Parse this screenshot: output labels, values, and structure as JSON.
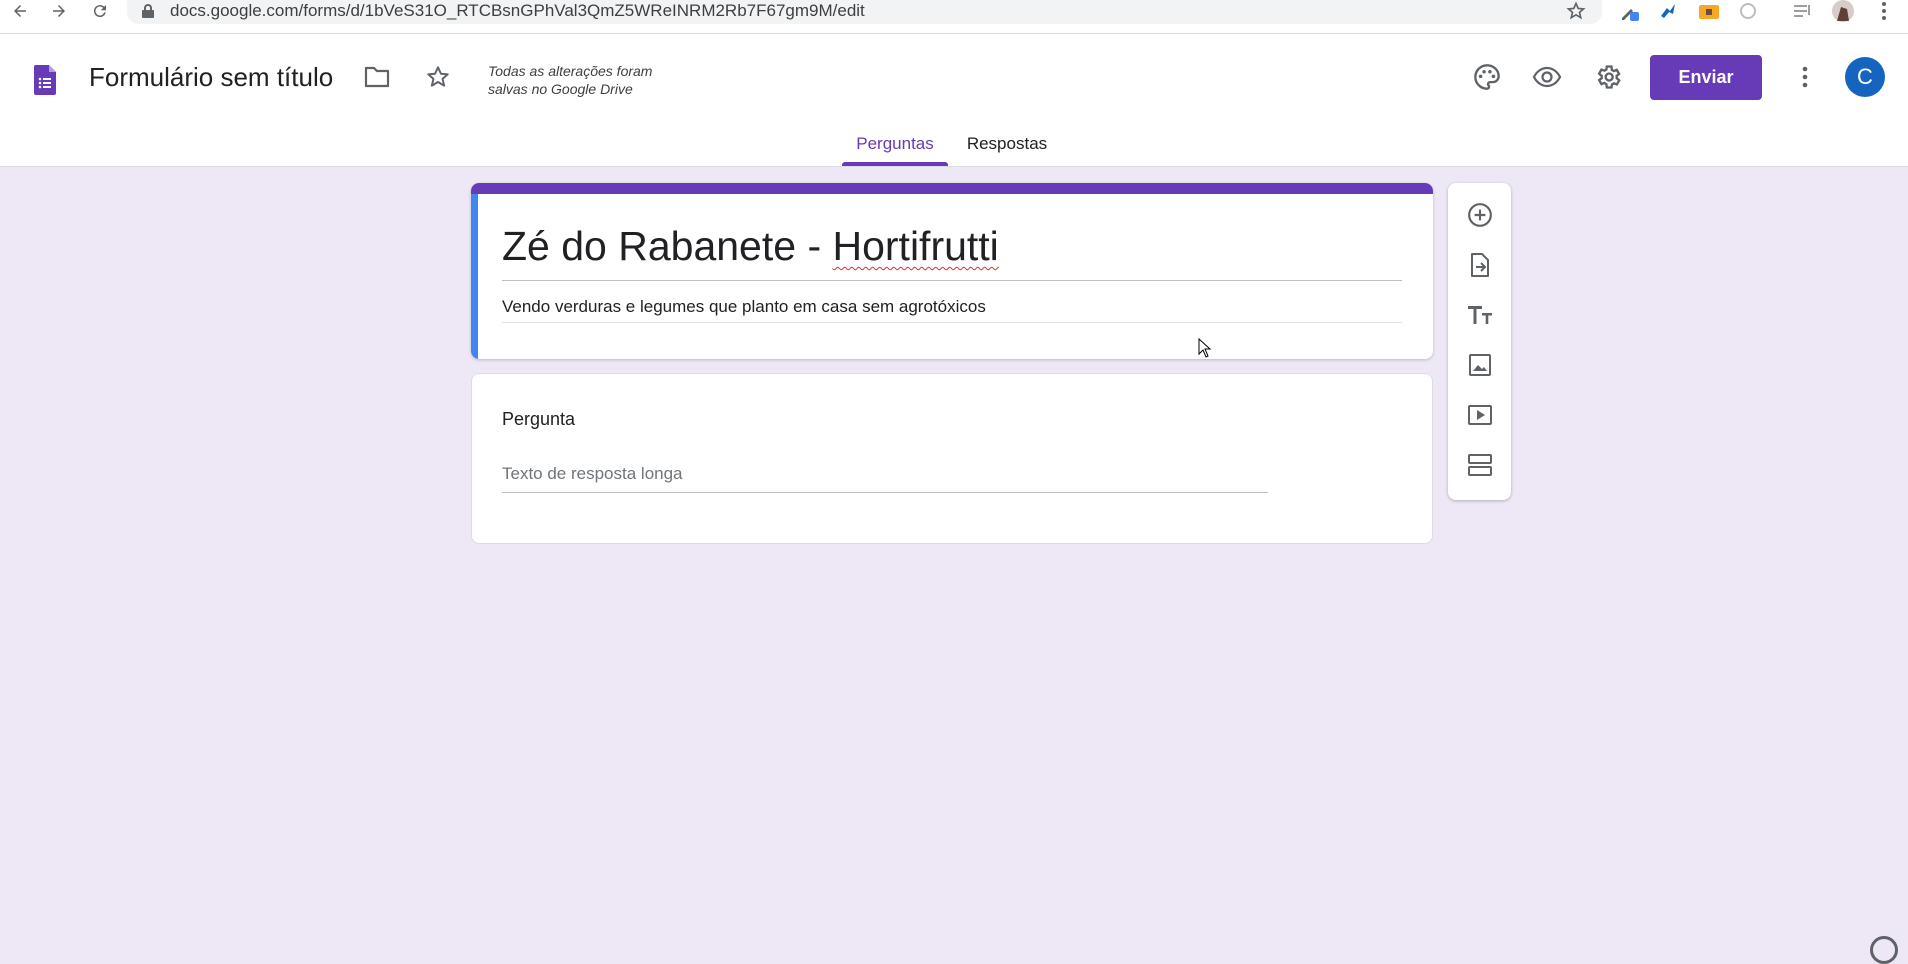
{
  "browser": {
    "url": "docs.google.com/forms/d/1bVeS31O_RTCBsnGPhVal3QmZ5WReINRM2Rb7F67gm9M/edit"
  },
  "header": {
    "doc_title": "Formulário sem título",
    "save_status_line1": "Todas as alterações foram",
    "save_status_line2": "salvas no Google Drive",
    "send_label": "Enviar",
    "avatar_letter": "C"
  },
  "tabs": [
    {
      "label": "Perguntas",
      "active": true
    },
    {
      "label": "Respostas",
      "active": false
    }
  ],
  "form": {
    "title_part1": "Zé do Rabanete - ",
    "title_part2": "Hortifrutti",
    "description": "Vendo verduras e legumes que planto em casa sem agrotóxicos"
  },
  "question": {
    "title": "Pergunta",
    "answer_placeholder": "Texto de resposta longa"
  },
  "side_toolbar": [
    "add-question-icon",
    "import-questions-icon",
    "add-title-icon",
    "add-image-icon",
    "add-video-icon",
    "add-section-icon"
  ],
  "colors": {
    "accent": "#673ab7",
    "background": "#ede7f6",
    "title_card_left_strip": "#4285f4",
    "avatar": "#1565c0"
  }
}
